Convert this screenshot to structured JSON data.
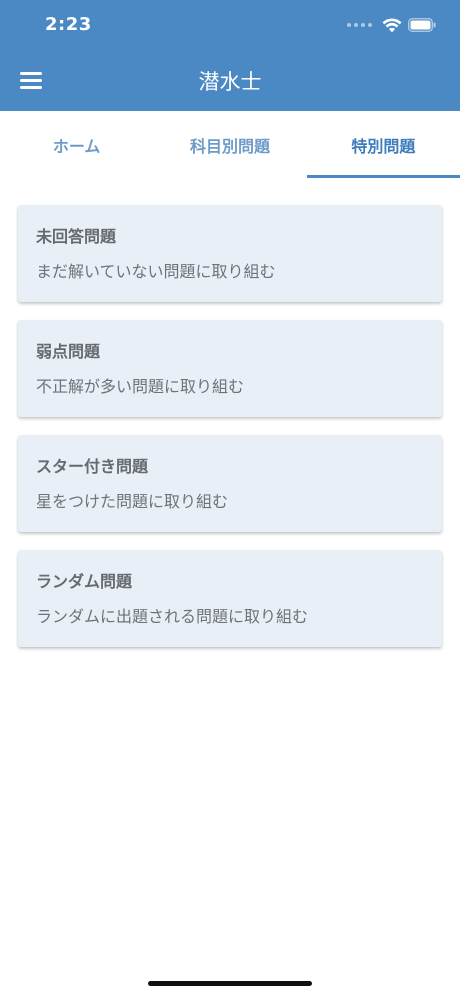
{
  "status_bar": {
    "time": "2:23"
  },
  "header": {
    "title": "潜水士",
    "menu_icon": "hamburger-menu-icon",
    "background_color": "#4a89c4"
  },
  "tabs": [
    {
      "label": "ホーム",
      "active": false
    },
    {
      "label": "科目別問題",
      "active": false
    },
    {
      "label": "特別問題",
      "active": true
    }
  ],
  "cards": [
    {
      "title": "未回答問題",
      "description": "まだ解いていない問題に取り組む"
    },
    {
      "title": "弱点問題",
      "description": "不正解が多い問題に取り組む"
    },
    {
      "title": "スター付き問題",
      "description": "星をつけた問題に取り組む"
    },
    {
      "title": "ランダム問題",
      "description": "ランダムに出題される問題に取り組む"
    }
  ]
}
